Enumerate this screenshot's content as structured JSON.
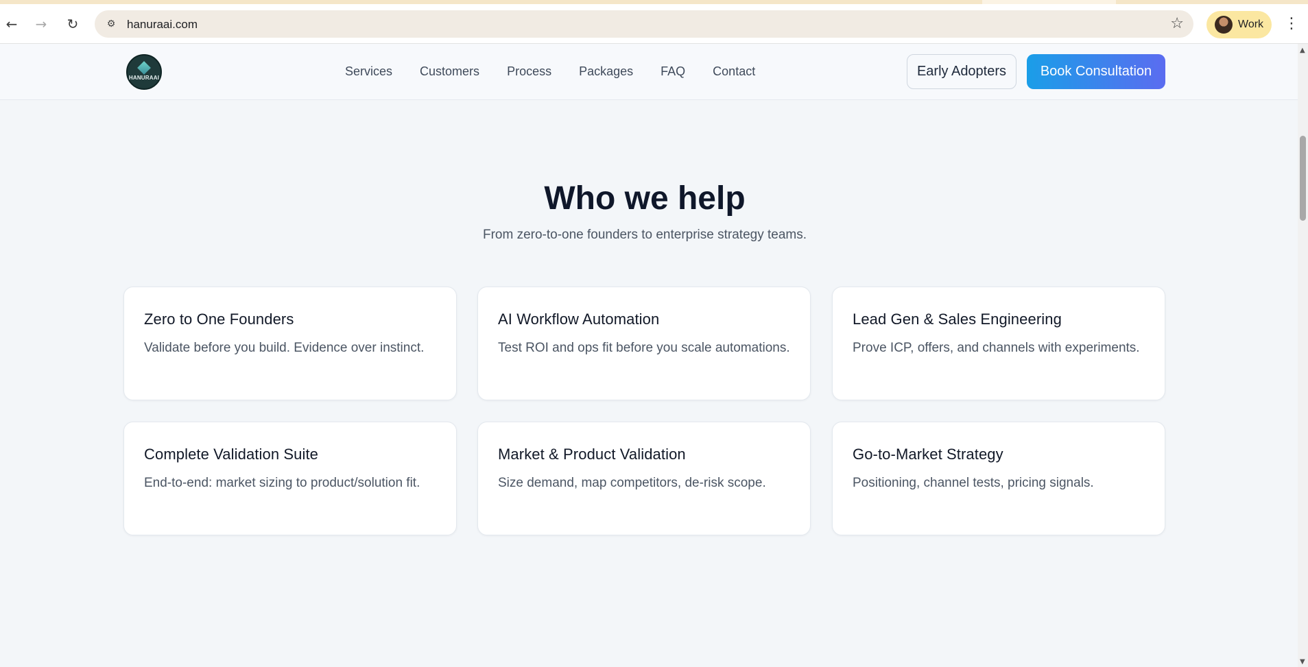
{
  "browser": {
    "url": "hanuraai.com",
    "profile_label": "Work"
  },
  "header": {
    "logo_text": "HANURAAI",
    "nav": [
      "Services",
      "Customers",
      "Process",
      "Packages",
      "FAQ",
      "Contact"
    ],
    "early_adopters_label": "Early Adopters",
    "book_consultation_label": "Book Consultation"
  },
  "section": {
    "title": "Who we help",
    "subtitle": "From zero-to-one founders to enterprise strategy teams.",
    "cards": [
      {
        "title": "Zero to One Founders",
        "desc": "Validate before you build. Evidence over instinct."
      },
      {
        "title": "AI Workflow Automation",
        "desc": "Test ROI and ops fit before you scale automations."
      },
      {
        "title": "Lead Gen & Sales Engineering",
        "desc": "Prove ICP, offers, and channels with experiments."
      },
      {
        "title": "Complete Validation Suite",
        "desc": "End-to-end: market sizing to product/solution fit."
      },
      {
        "title": "Market & Product Validation",
        "desc": "Size demand, map competitors, de-risk scope."
      },
      {
        "title": "Go-to-Market Strategy",
        "desc": "Positioning, channel tests, pricing signals."
      }
    ]
  }
}
